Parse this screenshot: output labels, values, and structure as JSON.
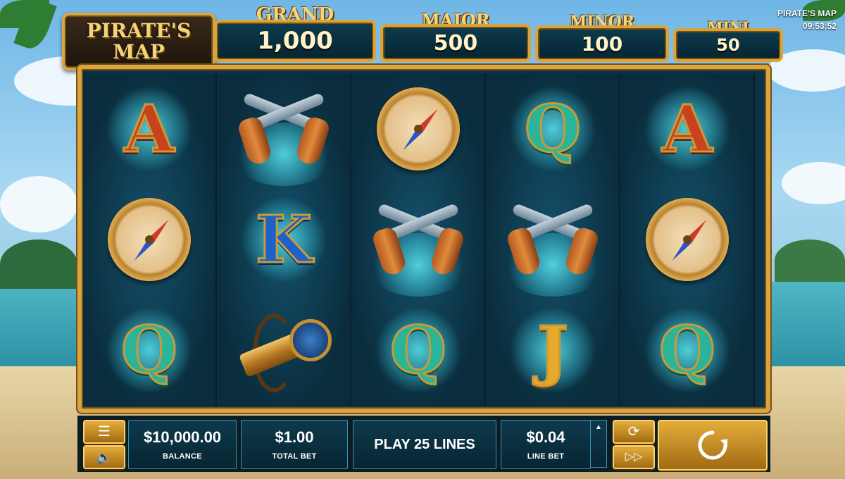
{
  "game": {
    "logo_line1": "PIRATE'S",
    "logo_line2": "MAP",
    "title": "PIRATE'S MAP",
    "clock": "09:53:52"
  },
  "jackpots": [
    {
      "name": "GRAND",
      "value": "1,000"
    },
    {
      "name": "MAJOR",
      "value": "500"
    },
    {
      "name": "MINOR",
      "value": "100"
    },
    {
      "name": "MINI",
      "value": "50"
    }
  ],
  "reels": [
    [
      "A",
      "compass",
      "Q"
    ],
    [
      "pistols",
      "K",
      "spyglass"
    ],
    [
      "compass",
      "pistols",
      "Q"
    ],
    [
      "Q",
      "pistols",
      "J"
    ],
    [
      "A",
      "compass",
      "Q"
    ]
  ],
  "controls": {
    "menu_icon": "hamburger-menu-icon",
    "sound_icon": "speaker-icon",
    "balance_value": "$10,000.00",
    "balance_label": "BALANCE",
    "total_bet_value": "$1.00",
    "total_bet_label": "TOTAL BET",
    "play_lines_label": "PLAY 25 LINES",
    "line_bet_value": "$0.04",
    "line_bet_label": "LINE BET",
    "autoplay_icon": "refresh-arrows-icon",
    "fast_forward_icon": "fast-forward-icon",
    "spin_icon": "spin-arrow-icon"
  },
  "colors": {
    "gold_frame": "#d9a441",
    "panel_bg": "#0e3a4c",
    "glow": "#5ae6f0"
  }
}
